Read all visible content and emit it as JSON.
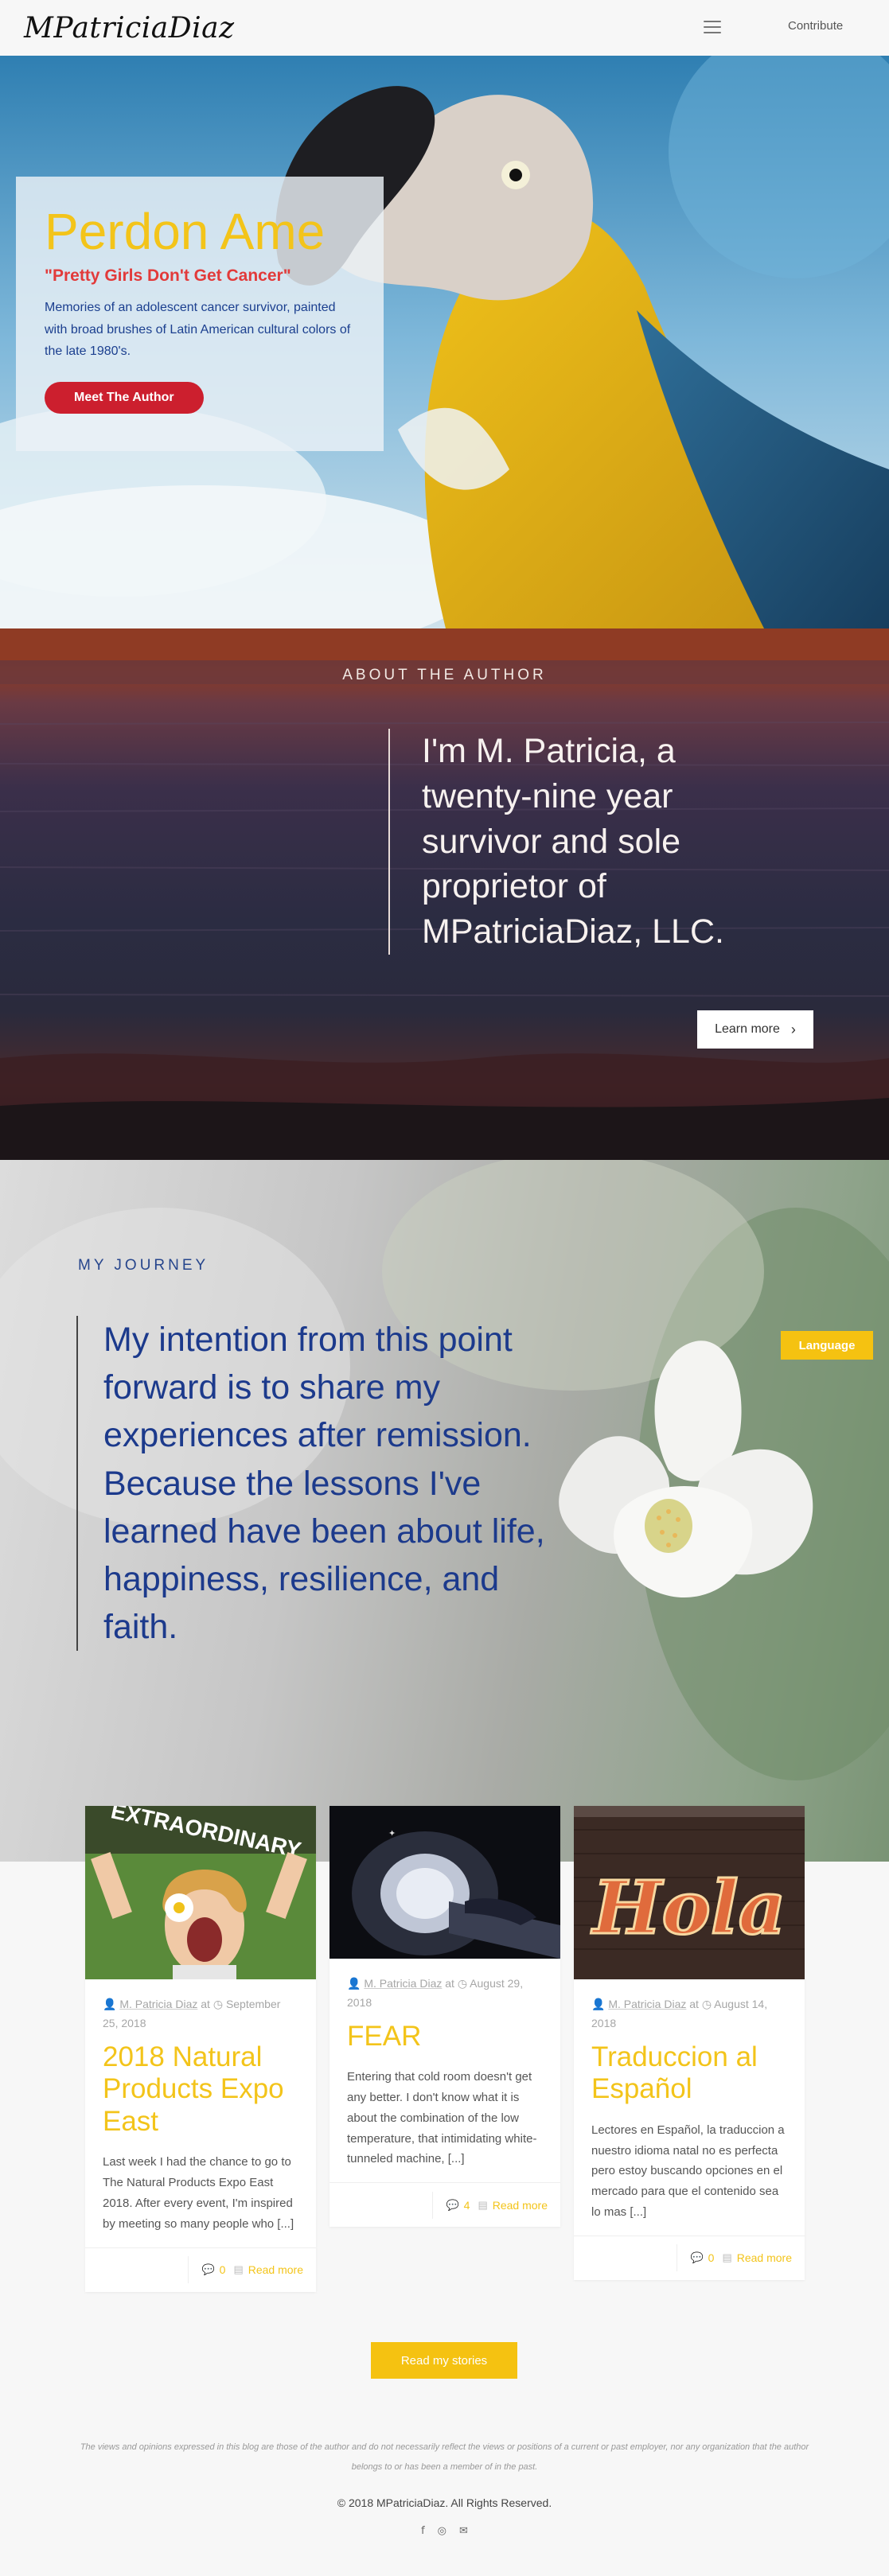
{
  "header": {
    "logo": "MPatriciaDiaz",
    "contribute": "Contribute"
  },
  "hero": {
    "title": "Perdon Ame",
    "subtitle": "\"Pretty Girls Don't Get Cancer\"",
    "description": "Memories of an adolescent cancer survivor, painted with broad brushes of Latin American cultural colors of the late 1980's.",
    "button": "Meet The Author"
  },
  "about": {
    "heading": "ABOUT THE AUTHOR",
    "quote": "I'm M. Patricia, a twenty-nine year survivor and sole proprietor of MPatriciaDiaz, LLC.",
    "button": "Learn more"
  },
  "journey": {
    "heading": "MY JOURNEY",
    "quote": "My intention from this point forward is to share my experiences after remission. Because the lessons I've learned have been about life, happiness, resilience, and faith.",
    "language_button": "Language"
  },
  "posts": [
    {
      "author": "M. Patricia Diaz",
      "at": "at",
      "date": "September 25, 2018",
      "title": "2018 Natural Products Expo East",
      "excerpt": "Last week I had the chance to go to The Natural Products Expo East 2018. After every event, I'm inspired by meeting so many people who [...]",
      "comments": "0",
      "read_more": "Read more",
      "image_text": "EXTRAORDINARY"
    },
    {
      "author": "M. Patricia Diaz",
      "at": "at",
      "date": "August 29, 2018",
      "title": "FEAR",
      "excerpt": "Entering that cold room doesn't get any better. I don't know what it is about the combination of the low temperature, that intimidating white-tunneled machine, [...]",
      "comments": "4",
      "read_more": "Read more"
    },
    {
      "author": "M. Patricia Diaz",
      "at": "at",
      "date": "August 14, 2018",
      "title": "Traduccion al Español",
      "excerpt": "Lectores en Español, la traduccion a nuestro idioma natal no es perfecta pero estoy buscando opciones en el mercado para que el contenido sea lo mas [...]",
      "comments": "0",
      "read_more": "Read more",
      "image_text": "Hola"
    }
  ],
  "blog": {
    "read_stories": "Read my stories"
  },
  "footer": {
    "disclaimer": "The views and opinions expressed in this blog are those of the author and do not necessarily reflect the views or positions of a current or past employer, nor any organization that the author belongs to or has been a member of in the past.",
    "copyright": "© 2018 MPatriciaDiaz. All Rights Reserved."
  },
  "colors": {
    "yellow": "#f3c41a",
    "red": "#cc1f2e",
    "navy": "#1c3a8c"
  }
}
